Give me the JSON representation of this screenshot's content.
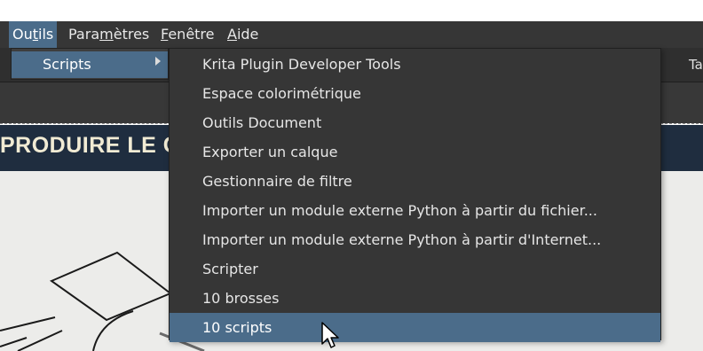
{
  "menubar": {
    "items": [
      {
        "label": "Outils",
        "active": true
      },
      {
        "label": "Paramètres"
      },
      {
        "label": "Fenêtre"
      },
      {
        "label": "Aide"
      }
    ]
  },
  "toolbar": {
    "right_tab_label": "Ta"
  },
  "banner": {
    "text": "PRODUIRE LE CI"
  },
  "submenu": {
    "label": "Scripts"
  },
  "scripts_menu": {
    "items": [
      "Krita Plugin Developer Tools",
      "Espace colorimétrique",
      "Outils Document",
      "Exporter un calque",
      "Gestionnaire de filtre",
      "Importer un module externe Python à partir du fichier...",
      "Importer un module externe Python à partir d'Internet...",
      "Scripter",
      "10 brosses",
      "10 scripts"
    ],
    "highlighted": "10 scripts"
  },
  "colors": {
    "accent": "#4b6c8a",
    "menu_bg": "#363636",
    "banner_bg": "#1f2d3f",
    "banner_text": "#f1ebd4"
  }
}
